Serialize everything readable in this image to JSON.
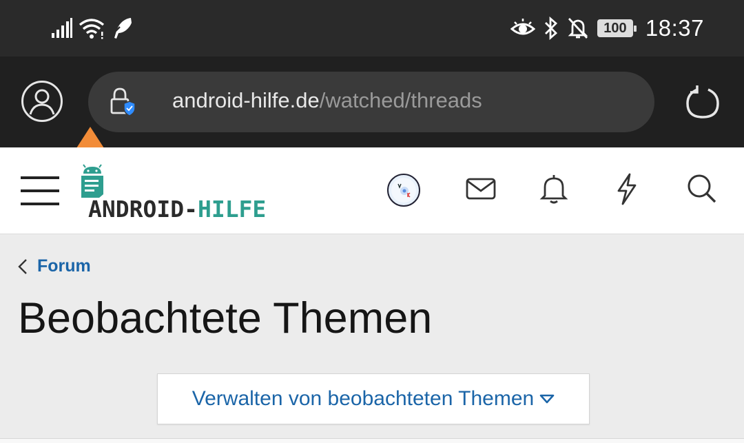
{
  "status_bar": {
    "time": "18:37",
    "battery_level": "100",
    "icons_left": [
      "signal-icon",
      "wifi-icon",
      "feather-icon"
    ],
    "icons_right": [
      "eye-icon",
      "bluetooth-icon",
      "notifications-off-icon",
      "battery-icon"
    ]
  },
  "browser": {
    "url_domain": "android-hilfe.de",
    "url_path": "/watched/threads",
    "icons": [
      "profile-icon",
      "lock-shield-icon",
      "reload-icon",
      "swipe-up-arrow-icon"
    ]
  },
  "site_header": {
    "logo_part1": "ANDROID-",
    "logo_part2": "HILFE",
    "icons": [
      "menu-icon",
      "avatar",
      "mail-icon",
      "bell-icon",
      "lightning-icon",
      "search-icon"
    ]
  },
  "content": {
    "breadcrumb_label": "Forum",
    "page_title": "Beobachtete Themen",
    "manage_button_label": "Verwalten von beobachteten Themen"
  },
  "colors": {
    "status_bar_bg": "#2a2a2a",
    "browser_bar_bg": "#202020",
    "url_pill_bg": "#3a3a3a",
    "link_blue": "#1b65a8",
    "logo_teal": "#2e9e8f",
    "arrow_orange": "#f28c38",
    "page_bg": "#ececec"
  }
}
